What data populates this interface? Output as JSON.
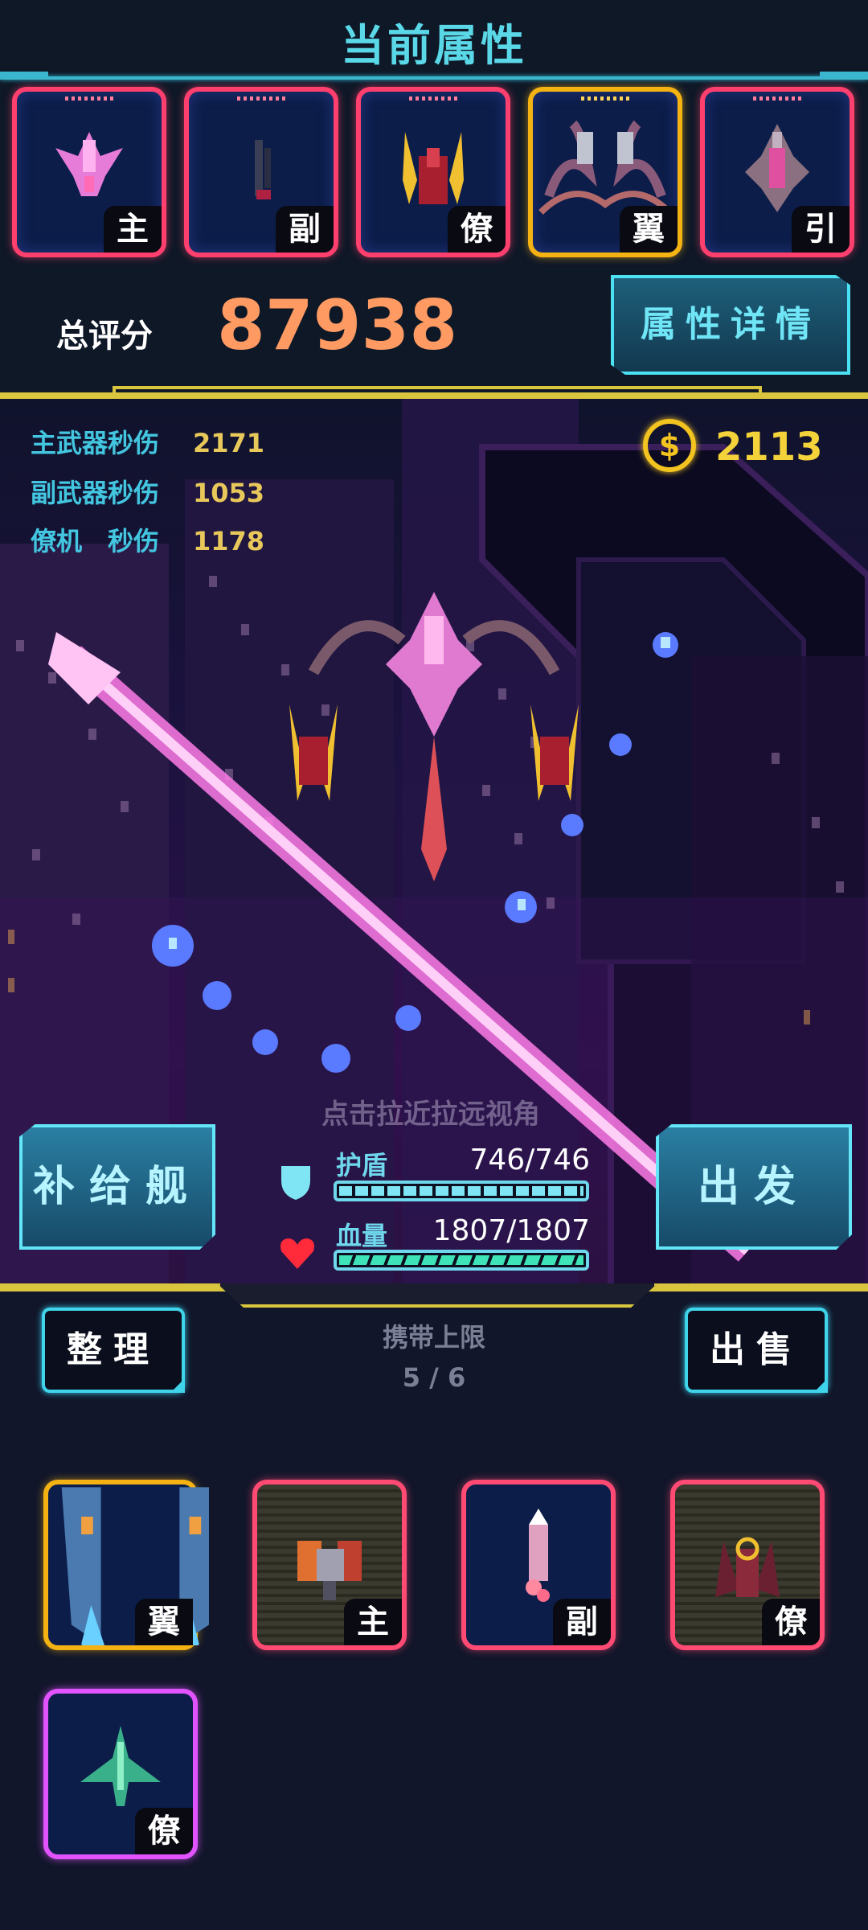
{
  "header": {
    "title": "当前属性"
  },
  "equipped": [
    {
      "tag": "主",
      "icon": "pink-main-ship-icon",
      "frame": "red"
    },
    {
      "tag": "副",
      "icon": "dark-cannon-icon",
      "frame": "red"
    },
    {
      "tag": "僚",
      "icon": "red-wingman-icon",
      "frame": "red"
    },
    {
      "tag": "翼",
      "icon": "tentacle-wing-icon",
      "frame": "gold"
    },
    {
      "tag": "引",
      "icon": "engine-ship-icon",
      "frame": "red"
    }
  ],
  "score": {
    "label": "总评分",
    "value": "87938"
  },
  "detail_button": {
    "label": "属性详情"
  },
  "stats": [
    {
      "label": "主武器秒伤",
      "value": "2171"
    },
    {
      "label": "副武器秒伤",
      "value": "1053"
    },
    {
      "label": "僚机　秒伤",
      "value": "1178"
    }
  ],
  "coins": {
    "icon": "coin-icon",
    "value": "2113"
  },
  "hint": "点击拉近拉远视角",
  "supply_button": {
    "label": "补给舰"
  },
  "depart_button": {
    "label": "出发"
  },
  "shield": {
    "label": "护盾",
    "value": "746/746",
    "current": 746,
    "max": 746,
    "icon": "shield-icon",
    "color": "#7fe5f5"
  },
  "hp": {
    "label": "血量",
    "value": "1807/1807",
    "current": 1807,
    "max": 1807,
    "icon": "heart-icon",
    "color": "#3ee3b7"
  },
  "inventory": {
    "sort_label": "整理",
    "sell_label": "出售",
    "capacity_label": "携带上限",
    "capacity_value": "5 / 6",
    "items": [
      {
        "tag": "翼",
        "icon": "blue-wing-pods-icon",
        "frame": "gold"
      },
      {
        "tag": "主",
        "icon": "orange-turret-icon",
        "frame": "red-striped"
      },
      {
        "tag": "副",
        "icon": "pink-missile-icon",
        "frame": "red"
      },
      {
        "tag": "僚",
        "icon": "dark-wingman-icon",
        "frame": "red-striped"
      },
      {
        "tag": "僚",
        "icon": "green-fighter-icon",
        "frame": "magenta"
      }
    ]
  },
  "colors": {
    "accent_cyan": "#43c6e0",
    "gold": "#d9c53e",
    "score": "#ff9a62",
    "frame_red": "#ff3f6d",
    "frame_gold": "#f5b313"
  }
}
